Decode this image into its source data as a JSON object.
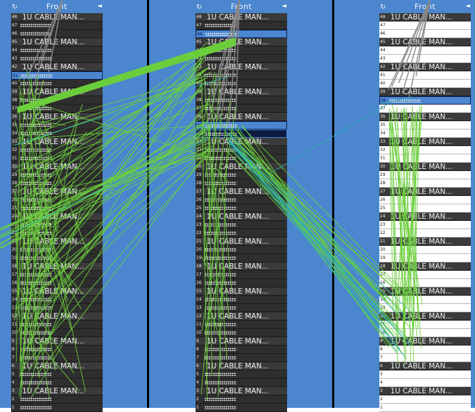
{
  "view_title": "Front",
  "racks": [
    {
      "id": "A",
      "header_icon": "rotate-icon",
      "arrow_icon": "collapse-arrow-icon"
    },
    {
      "id": "B",
      "header_icon": "rotate-icon",
      "arrow_icon": "collapse-arrow-icon"
    },
    {
      "id": "C",
      "header_icon": "rotate-icon",
      "arrow_icon": "collapse-arrow-icon"
    }
  ],
  "device_label": "1U CABLE MAN...",
  "colors": {
    "background": "#4b86cf",
    "cable_green": "#6ccf3c",
    "cable_teal": "#2fb3b0",
    "cable_gray": "#8a8a8a",
    "device": "#3a3a3a"
  },
  "icons": {
    "header": "↻",
    "arrow": "◄"
  }
}
